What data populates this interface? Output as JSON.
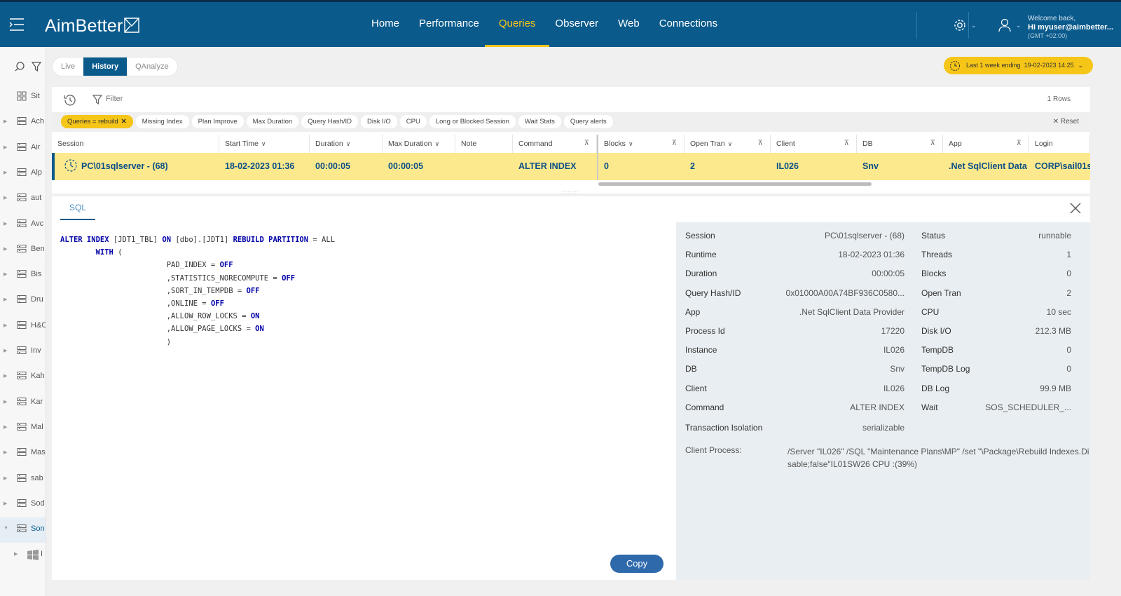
{
  "header": {
    "logo": "AimBetter",
    "nav": [
      "Home",
      "Performance",
      "Queries",
      "Observer",
      "Web",
      "Connections"
    ],
    "active_nav": "Queries",
    "welcome": "Welcome back,",
    "user": "Hi myuser@aimbetter...",
    "timezone": "(GMT +02:00)"
  },
  "sidebar": {
    "items": [
      {
        "label": "Sit",
        "icon": "grid-icon"
      },
      {
        "label": "Ach",
        "icon": "server-icon"
      },
      {
        "label": "Air",
        "icon": "server-icon"
      },
      {
        "label": "Alp",
        "icon": "server-icon"
      },
      {
        "label": "aut",
        "icon": "server-icon"
      },
      {
        "label": "Avc",
        "icon": "server-icon"
      },
      {
        "label": "Ben",
        "icon": "server-icon"
      },
      {
        "label": "Bis",
        "icon": "server-icon"
      },
      {
        "label": "Dru",
        "icon": "server-icon"
      },
      {
        "label": "H&C",
        "icon": "server-icon"
      },
      {
        "label": "Inv",
        "icon": "server-icon"
      },
      {
        "label": "Kah",
        "icon": "server-icon"
      },
      {
        "label": "Kar",
        "icon": "server-icon"
      },
      {
        "label": "Mal",
        "icon": "server-icon"
      },
      {
        "label": "Mas",
        "icon": "server-icon"
      },
      {
        "label": "sab",
        "icon": "server-icon"
      },
      {
        "label": "Sod",
        "icon": "server-icon"
      },
      {
        "label": "Son",
        "icon": "server-icon"
      },
      {
        "label": "I",
        "icon": "windows-icon"
      }
    ]
  },
  "modes": {
    "items": [
      "Live",
      "History",
      "QAnalyze"
    ],
    "active": "History"
  },
  "timerange": {
    "label": "Last 1 week ending",
    "value": "19-02-2023 14:25"
  },
  "filterbar": {
    "filter_label": "Filter",
    "rows": "1 Rows",
    "reset": "Reset"
  },
  "chips": [
    {
      "label": "Queries = rebuild",
      "active": true
    },
    {
      "label": "Missing Index"
    },
    {
      "label": "Plan Improve"
    },
    {
      "label": "Max Duration"
    },
    {
      "label": "Query Hash/ID"
    },
    {
      "label": "Disk I/O"
    },
    {
      "label": "CPU"
    },
    {
      "label": "Long or Blocked Session"
    },
    {
      "label": "Wait Stats"
    },
    {
      "label": "Query alerts"
    }
  ],
  "table": {
    "columns": [
      "Session",
      "Start Time",
      "Duration",
      "Max Duration",
      "Note",
      "Command",
      "Blocks",
      "Open Tran",
      "Client",
      "DB",
      "App",
      "Login"
    ],
    "row": {
      "session": "PC\\01sqlserver - (68)",
      "start_time": "18-02-2023 01:36",
      "duration": "00:00:05",
      "max_duration": "00:00:05",
      "note": "",
      "command": "ALTER INDEX",
      "blocks": "0",
      "open_tran": "2",
      "client": "IL026",
      "db": "Snv",
      "app": ".Net SqlClient Data P",
      "login": "CORP\\sail01s"
    }
  },
  "detail": {
    "tab": "SQL",
    "copy": "Copy",
    "sql_lines": [
      [
        {
          "t": "ALTER INDEX",
          "k": true
        },
        {
          "t": " [JDT1_TBL] "
        },
        {
          "t": "ON",
          "k": true
        },
        {
          "t": " [dbo].[JDT1] "
        },
        {
          "t": "REBUILD PARTITION",
          "k": true
        },
        {
          "t": " = ALL"
        }
      ],
      [
        {
          "t": "        "
        },
        {
          "t": "WITH",
          "k": true
        },
        {
          "t": " ("
        }
      ],
      [
        {
          "t": "                        PAD_INDEX = "
        },
        {
          "t": "OFF",
          "k": true
        }
      ],
      [
        {
          "t": "                        ,STATISTICS_NORECOMPUTE = "
        },
        {
          "t": "OFF",
          "k": true
        }
      ],
      [
        {
          "t": "                        ,SORT_IN_TEMPDB = "
        },
        {
          "t": "OFF",
          "k": true
        }
      ],
      [
        {
          "t": "                        ,ONLINE = "
        },
        {
          "t": "OFF",
          "k": true
        }
      ],
      [
        {
          "t": "                        ,ALLOW_ROW_LOCKS = "
        },
        {
          "t": "ON",
          "k": true
        }
      ],
      [
        {
          "t": "                        ,ALLOW_PAGE_LOCKS = "
        },
        {
          "t": "ON",
          "k": true
        }
      ],
      [
        {
          "t": "                        )"
        }
      ]
    ],
    "info_left": [
      {
        "k": "Session",
        "v": "PC\\01sqlserver - (68)"
      },
      {
        "k": "Runtime",
        "v": "18-02-2023 01:36"
      },
      {
        "k": "Duration",
        "v": "00:00:05"
      },
      {
        "k": "Query Hash/ID",
        "v": "0x01000A00A74BF936C0580..."
      },
      {
        "k": "App",
        "v": ".Net SqlClient Data Provider"
      },
      {
        "k": "Process Id",
        "v": "17220"
      },
      {
        "k": "Instance",
        "v": "IL026"
      },
      {
        "k": "DB",
        "v": "Snv"
      },
      {
        "k": "Client",
        "v": "IL026"
      },
      {
        "k": "Command",
        "v": "ALTER INDEX"
      },
      {
        "k": "Transaction Isolation",
        "v": "serializable"
      }
    ],
    "info_right": [
      {
        "k": "Status",
        "v": "runnable"
      },
      {
        "k": "Threads",
        "v": "1"
      },
      {
        "k": "Blocks",
        "v": "0"
      },
      {
        "k": "Open Tran",
        "v": "2"
      },
      {
        "k": "CPU",
        "v": "10 sec"
      },
      {
        "k": "Disk I/O",
        "v": "212.3 MB"
      },
      {
        "k": "TempDB",
        "v": "0"
      },
      {
        "k": "TempDB Log",
        "v": "0"
      },
      {
        "k": "DB Log",
        "v": "99.9 MB"
      },
      {
        "k": "Wait",
        "v": "SOS_SCHEDULER_..."
      }
    ],
    "client_process_label": "Client Process:",
    "client_process": "/Server \"IL026\" /SQL \"Maintenance Plans\\MP\" /set \"\\Package\\Rebuild Indexes.Disable;false\"IL01SW26 CPU :(39%)"
  }
}
